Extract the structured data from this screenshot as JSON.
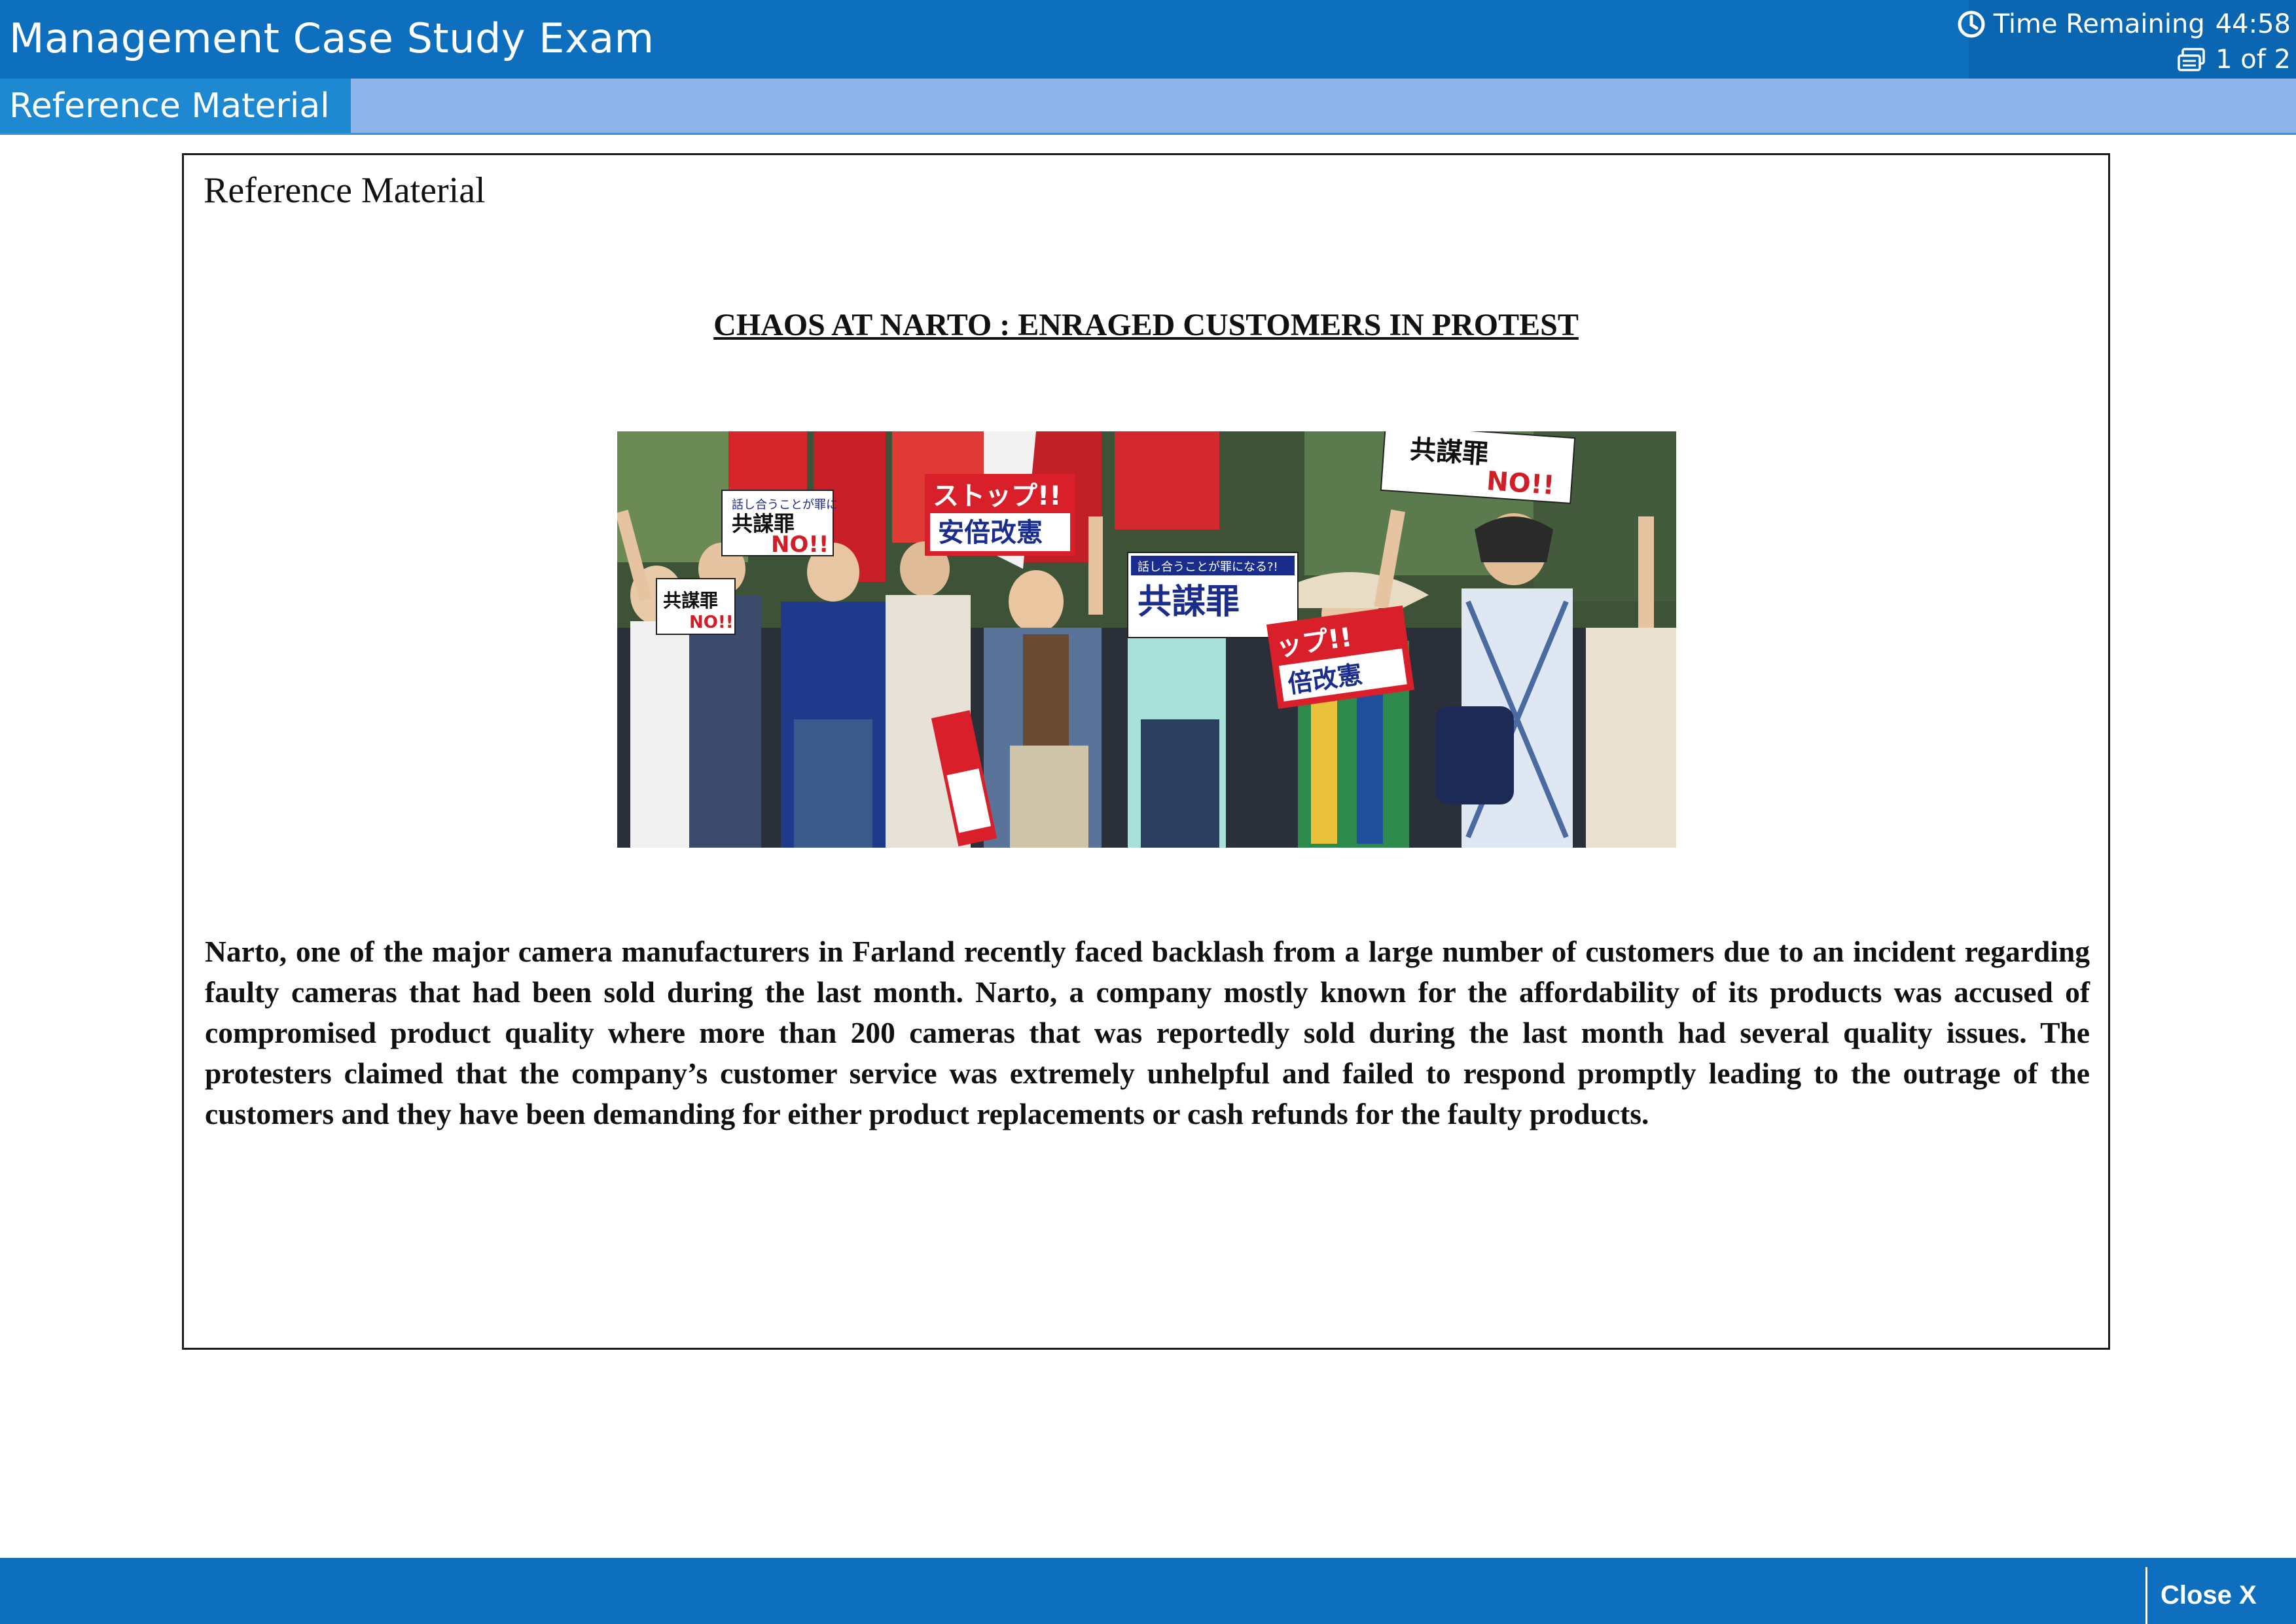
{
  "header": {
    "title": "Management Case Study Exam",
    "timer_label": "Time Remaining",
    "timer_value": "44:58",
    "page_indicator": "1 of 2"
  },
  "subheader": {
    "tab_label": "Reference Material"
  },
  "reference": {
    "heading": "Reference Material",
    "article_title": "CHAOS AT NARTO : ENRAGED CUSTOMERS IN PROTEST",
    "photo": {
      "signs": [
        "共謀罪",
        "NO!!",
        "ストップ!!",
        "安倍改憲",
        "共謀罪",
        "NO!!",
        "ップ!!",
        "倍改憲",
        "話し合うことが罪になる?!"
      ]
    },
    "body": "Narto, one of the major camera manufacturers in Farland recently faced backlash from a large number of customers due to an incident regarding faulty cameras that had been sold during the last month. Narto, a company mostly known for the affordability of its products was accused of compromised product quality where more than 200 cameras that was reportedly sold during the last month had several quality issues. The protesters claimed that the company’s customer service was extremely unhelpful and failed to respond promptly leading to the outrage of the customers and they have been demanding for either product replacements or cash refunds for the faulty products."
  },
  "footer": {
    "close_label": "Close X"
  },
  "colors": {
    "header_blue": "#0d6fbe",
    "subheader_blue": "#8db4e8",
    "tab_blue": "#1e88d0"
  },
  "icons": {
    "timer": "clock-icon",
    "pager": "pages-icon"
  }
}
